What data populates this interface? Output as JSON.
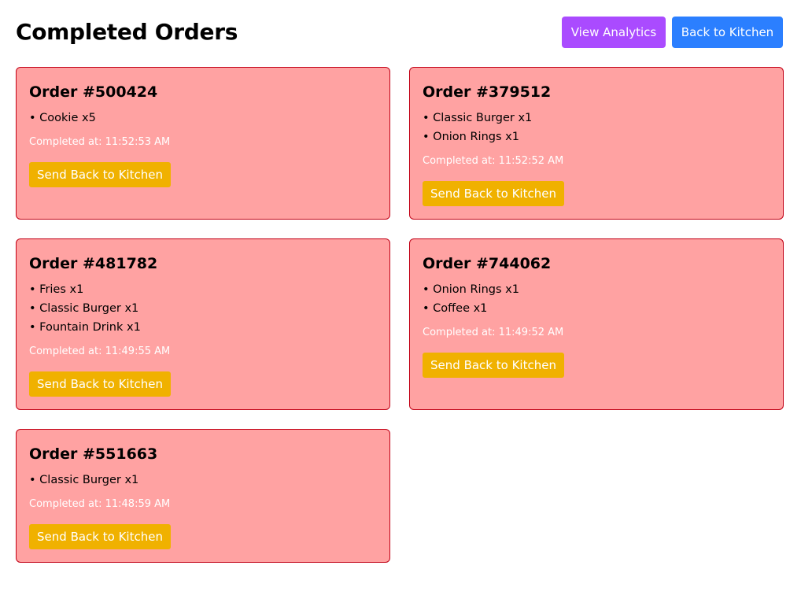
{
  "header": {
    "title": "Completed Orders",
    "view_analytics_label": "View Analytics",
    "back_to_kitchen_label": "Back to Kitchen"
  },
  "orders": [
    {
      "title": "Order #500424",
      "items": [
        "• Cookie x5"
      ],
      "completed": "Completed at: 11:52:53 AM",
      "button_label": "Send Back to Kitchen"
    },
    {
      "title": "Order #379512",
      "items": [
        "• Classic Burger x1",
        "• Onion Rings x1"
      ],
      "completed": "Completed at: 11:52:52 AM",
      "button_label": "Send Back to Kitchen"
    },
    {
      "title": "Order #481782",
      "items": [
        "• Fries x1",
        "• Classic Burger x1",
        "• Fountain Drink x1"
      ],
      "completed": "Completed at: 11:49:55 AM",
      "button_label": "Send Back to Kitchen"
    },
    {
      "title": "Order #744062",
      "items": [
        "• Onion Rings x1",
        "• Coffee x1"
      ],
      "completed": "Completed at: 11:49:52 AM",
      "button_label": "Send Back to Kitchen"
    },
    {
      "title": "Order #551663",
      "items": [
        "• Classic Burger x1"
      ],
      "completed": "Completed at: 11:48:59 AM",
      "button_label": "Send Back to Kitchen"
    }
  ],
  "colors": {
    "card_background": "#ffa2a2",
    "card_border": "#c10015",
    "send_button": "#f0b100",
    "analytics_button": "#aa4bff",
    "kitchen_button": "#2b7fff"
  }
}
